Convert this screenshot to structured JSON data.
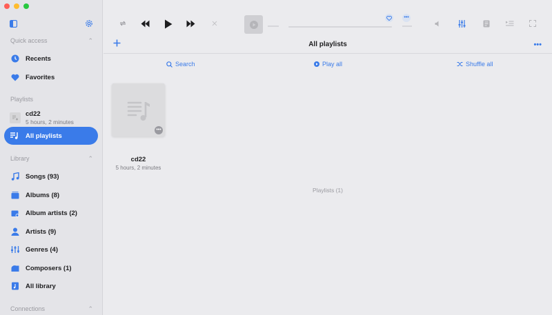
{
  "window": {
    "lights": [
      "#ff5f57",
      "#febc2e",
      "#28c840"
    ]
  },
  "sidebar": {
    "sections": {
      "quick_access": "Quick access",
      "playlists": "Playlists",
      "library": "Library",
      "connections": "Connections"
    },
    "quick_access_items": [
      {
        "label": "Recents",
        "icon": "clock-icon"
      },
      {
        "label": "Favorites",
        "icon": "heart-icon"
      }
    ],
    "playlist_entry": {
      "title": "cd22",
      "subtitle": "5 hours, 2 minutes"
    },
    "all_playlists": "All playlists",
    "library_items": [
      {
        "label": "Songs (93)",
        "icon": "music-note-icon"
      },
      {
        "label": "Albums (8)",
        "icon": "albums-icon"
      },
      {
        "label": "Album artists (2)",
        "icon": "album-artists-icon"
      },
      {
        "label": "Artists (9)",
        "icon": "person-icon"
      },
      {
        "label": "Genres (4)",
        "icon": "genres-icon"
      },
      {
        "label": "Composers (1)",
        "icon": "piano-icon"
      },
      {
        "label": "All library",
        "icon": "library-icon"
      }
    ]
  },
  "header": {
    "title": "All playlists"
  },
  "actions": {
    "search": "Search",
    "play_all": "Play all",
    "shuffle_all": "Shuffle all"
  },
  "playlists": [
    {
      "title": "cd22",
      "subtitle": "5 hours, 2 minutes"
    }
  ],
  "playlist_count": "Playlists (1)",
  "colors": {
    "accent": "#3a7be9",
    "icon_gray": "#8e8e93"
  }
}
